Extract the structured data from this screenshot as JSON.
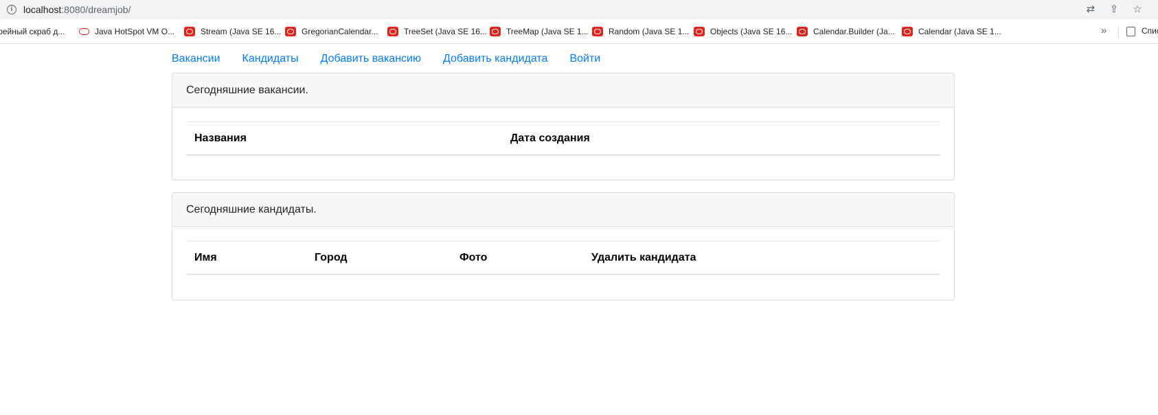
{
  "browser": {
    "url_host": "localhost",
    "url_path": ":8080/dreamjob/",
    "bookmarks": [
      "фейный скраб д...",
      "Java HotSpot VM O...",
      "Stream (Java SE 16...",
      "GregorianCalendar...",
      "TreeSet (Java SE 16...",
      "TreeMap (Java SE 1...",
      "Random (Java SE 1...",
      "Objects (Java SE 16...",
      "Calendar.Builder (Ja...",
      "Calendar (Java SE 1..."
    ],
    "more_label": "»",
    "reading_list_label": "Спис"
  },
  "nav": {
    "vacancies": "Вакансии",
    "candidates": "Кандидаты",
    "add_vacancy": "Добавить вакансию",
    "add_candidate": "Добавить кандидата",
    "login": "Войти"
  },
  "vacancies_card": {
    "title": "Сегодняшние вакансии.",
    "columns": [
      "Названия",
      "Дата создания"
    ],
    "rows": []
  },
  "candidates_card": {
    "title": "Сегодняшние кандидаты.",
    "columns": [
      "Имя",
      "Город",
      "Фото",
      "Удалить кандидата"
    ],
    "rows": []
  },
  "colors": {
    "link": "#007bff",
    "bookmark_icon": "#e2231a",
    "card_header_bg": "#f7f7f7"
  }
}
